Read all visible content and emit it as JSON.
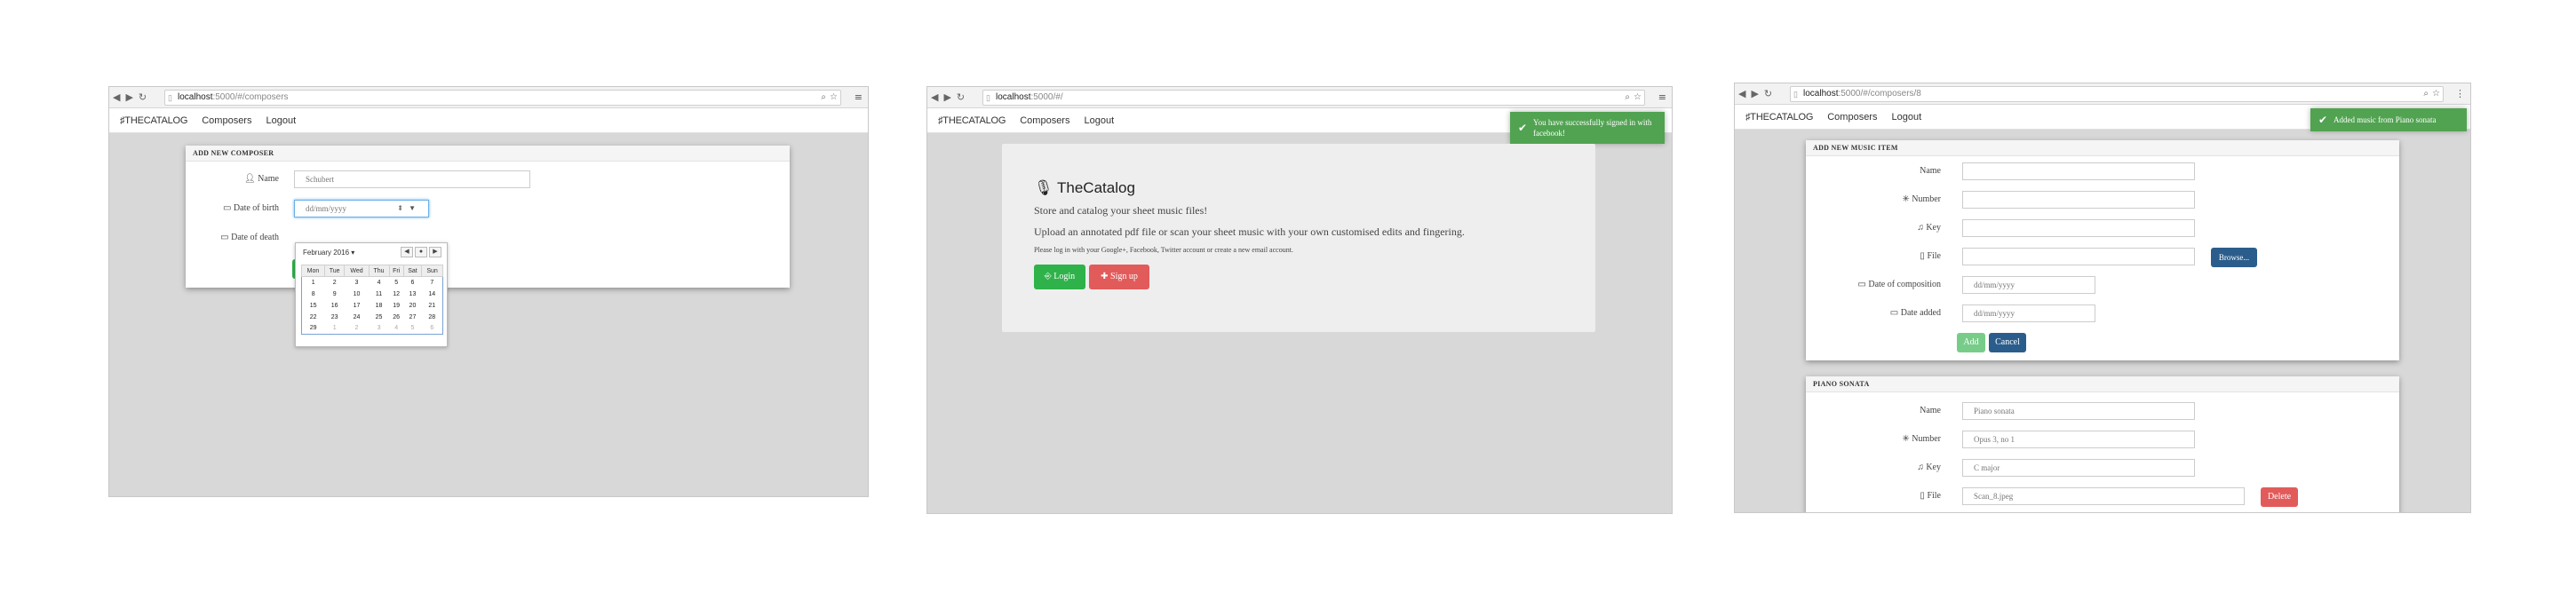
{
  "screens": [
    {
      "url_host": "localhost",
      "url_path": ":5000/#/composers",
      "nav": {
        "brand": "♯THECATALOG",
        "items": [
          "Composers",
          "Logout"
        ]
      },
      "panel_title": "ADD NEW COMPOSER",
      "fields": {
        "name_label": "Name",
        "name_value": "Schubert",
        "dob_label": "Date of birth",
        "dob_value": "dd/mm/yyyy",
        "dod_label": "Date of death"
      },
      "calendar": {
        "month": "February 2016 ▾",
        "weekdays": [
          "Mon",
          "Tue",
          "Wed",
          "Thu",
          "Fri",
          "Sat",
          "Sun"
        ],
        "weeks": [
          [
            "1",
            "2",
            "3",
            "4",
            "5",
            "6",
            "7"
          ],
          [
            "8",
            "9",
            "10",
            "11",
            "12",
            "13",
            "14"
          ],
          [
            "15",
            "16",
            "17",
            "18",
            "19",
            "20",
            "21"
          ],
          [
            "22",
            "23",
            "24",
            "25",
            "26",
            "27",
            "28"
          ],
          [
            "29",
            "1",
            "2",
            "3",
            "4",
            "5",
            "6"
          ]
        ]
      }
    },
    {
      "url_host": "localhost",
      "url_path": ":5000/#/",
      "nav": {
        "brand": "♯THECATALOG",
        "items": [
          "Composers",
          "Logout"
        ]
      },
      "toast": "You have successfully signed in with facebook!",
      "hero": {
        "title": "TheCatalog",
        "tagline": "Store and catalog your sheet music files!",
        "lead": "Upload an annotated pdf file or scan your sheet music with your own customised edits and fingering.",
        "small": "Please log in with your Google+, Facebook, Twitter account or create a new email account.",
        "login": "Login",
        "signup": "Sign up"
      }
    },
    {
      "url_host": "localhost",
      "url_path": ":5000/#/composers/8",
      "nav": {
        "brand": "♯THECATALOG",
        "items": [
          "Composers",
          "Logout"
        ]
      },
      "toast": "Added music from Piano sonata",
      "add_panel": {
        "title": "ADD NEW MUSIC ITEM",
        "labels": [
          "Name",
          "Number",
          "Key",
          "File",
          "Date of composition",
          "Date added"
        ],
        "date_placeholder": "dd/mm/yyyy",
        "browse": "Browse...",
        "add": "Add",
        "cancel": "Cancel"
      },
      "item_panel": {
        "title": "PIANO SONATA",
        "labels": [
          "Name",
          "Number",
          "Key",
          "File"
        ],
        "values": [
          "Piano sonata",
          "Opus 3, no 1",
          "C major",
          "Scan_8.jpeg"
        ],
        "delete": "Delete"
      }
    }
  ],
  "colors": {
    "success": "#51a351",
    "primary": "#2fb24a",
    "danger": "#e25b5b",
    "navy": "#2b5d8c"
  }
}
